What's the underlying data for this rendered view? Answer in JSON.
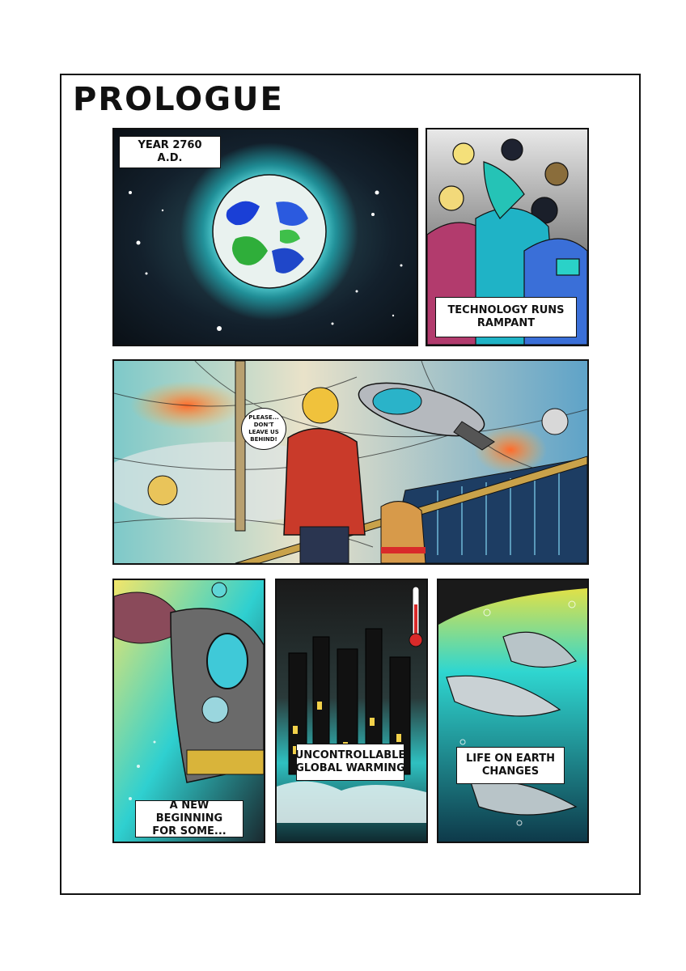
{
  "title": "PROLOGUE",
  "panels": {
    "p1": {
      "caption": "YEAR 2760 A.D."
    },
    "p2": {
      "caption": "TECHNOLOGY RUNS RAMPANT"
    },
    "p3": {
      "speech": "PLEASE... DON'T LEAVE US BEHIND!"
    },
    "p4": {
      "caption": "A NEW BEGINNING FOR SOME..."
    },
    "p5": {
      "caption": "UNCONTROLLABLE GLOBAL WARMING"
    },
    "p6": {
      "caption": "LIFE ON EARTH CHANGES"
    }
  },
  "icons": [
    "earth-icon",
    "thermometer-icon",
    "spaceship-icon",
    "shark-icon"
  ],
  "colors": {
    "space": "#0d1a2a",
    "glow": "#3fd6d6",
    "earth_blue": "#1a3fd6",
    "earth_green": "#2fae3a"
  }
}
